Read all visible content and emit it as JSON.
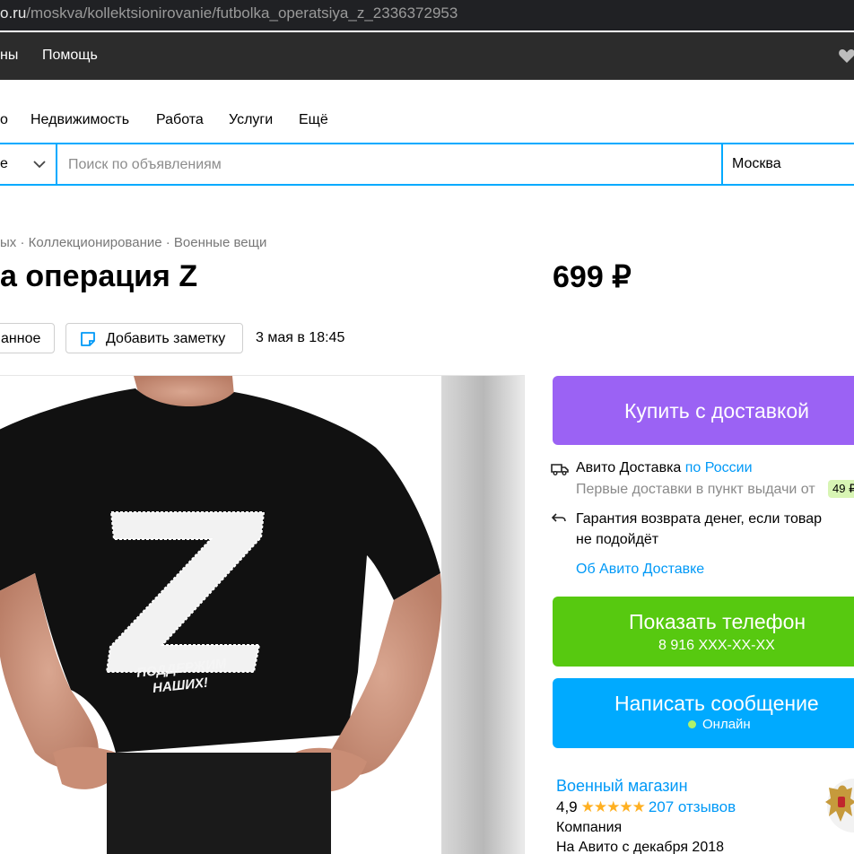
{
  "browser": {
    "url_host": "o.ru",
    "url_path": "/moskva/kollektsionirovanie/futbolka_operatsiya_z_2336372953"
  },
  "topbar": {
    "link_partial": "ны",
    "help": "Помощь"
  },
  "categories": [
    "о",
    "Недвижимость",
    "Работа",
    "Услуги",
    "Ещё"
  ],
  "search": {
    "category_partial": "е",
    "placeholder": "Поиск по объявлениям",
    "city": "Москва"
  },
  "breadcrumbs": "ых · Коллекционирование · Военные вещи",
  "listing": {
    "title": "а операция Z",
    "price": "699 ₽",
    "favorite_partial": "анное",
    "add_note": "Добавить заметку",
    "date": "3 мая в 18:45"
  },
  "image": {
    "slogan_line1": "ПОДДЕРЖИМ",
    "slogan_line2": "НАШИХ!"
  },
  "buy": {
    "label": "Купить с доставкой"
  },
  "delivery": {
    "service": "Авито Доставка",
    "scope": "по России",
    "first_delivery": "Первые доставки в пункт выдачи от",
    "first_delivery_price": "49 ₽",
    "guarantee_line1": "Гарантия возврата денег, если товар",
    "guarantee_line2": "не подойдёт",
    "about_link": "Об Авито Доставке"
  },
  "contact": {
    "show_phone": "Показать телефон",
    "phone_masked": "8 916 XXX-XX-XX",
    "write_message": "Написать сообщение",
    "online": "Онлайн"
  },
  "seller": {
    "name": "Военный магазин",
    "rating": "4,9",
    "stars": "★★★★★",
    "reviews": "207 отзывов",
    "type": "Компания",
    "since": "На Авито с декабря 2018"
  },
  "colors": {
    "buy": "#9b62f4",
    "phone": "#57c910",
    "message": "#00aaff",
    "link": "#0099f7"
  }
}
